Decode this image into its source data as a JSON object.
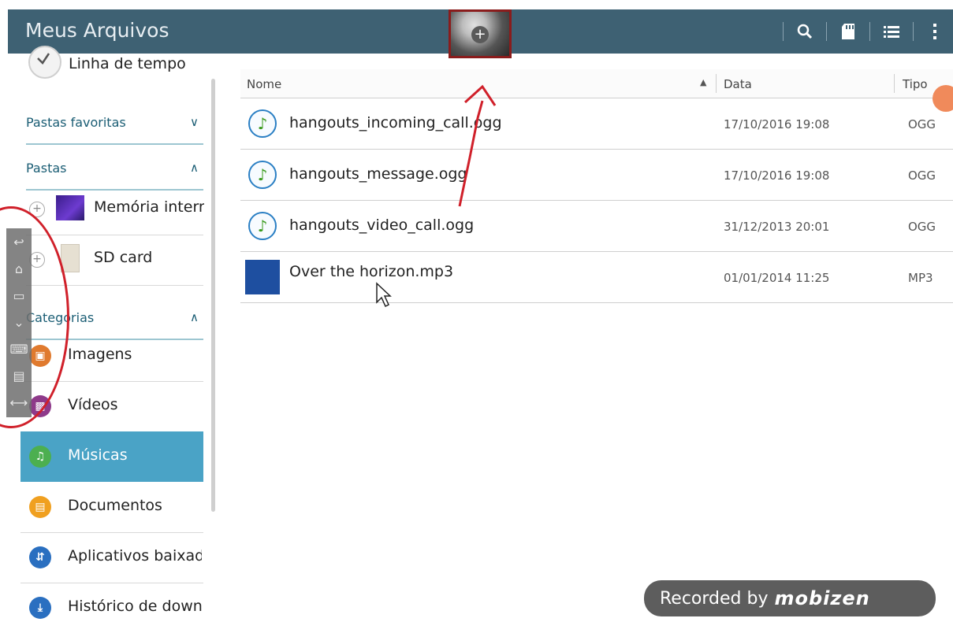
{
  "app": {
    "title": "Meus Arquivos"
  },
  "toolbar": {
    "icons": [
      "search-icon",
      "sd-card-icon",
      "list-view-icon",
      "more-vert-icon"
    ]
  },
  "sidebar": {
    "timeline_label": "Linha de tempo",
    "favorites_header": "Pastas favoritas",
    "folders_header": "Pastas",
    "folders": [
      {
        "label": "Memória interna"
      },
      {
        "label": "SD card"
      }
    ],
    "categories_header": "Categorias",
    "categories": [
      {
        "label": "Imagens",
        "color": "#e07a2e"
      },
      {
        "label": "Vídeos",
        "color": "#8e3a8a"
      },
      {
        "label": "Músicas",
        "color": "#4caf50",
        "selected": true
      },
      {
        "label": "Documentos",
        "color": "#f0a020"
      },
      {
        "label": "Aplicativos baixados",
        "color": "#2a6fc0"
      },
      {
        "label": "Histórico de download",
        "color": "#2a6fc0"
      }
    ]
  },
  "list": {
    "columns": {
      "name": "Nome",
      "date": "Data",
      "type": "Tipo"
    },
    "files": [
      {
        "name": "hangouts_incoming_call.ogg",
        "date": "17/10/2016 19:08",
        "type": "OGG",
        "icon": "music-note-icon"
      },
      {
        "name": "hangouts_message.ogg",
        "date": "17/10/2016 19:08",
        "type": "OGG",
        "icon": "music-note-icon"
      },
      {
        "name": "hangouts_video_call.ogg",
        "date": "31/12/2013 20:01",
        "type": "OGG",
        "icon": "music-note-icon"
      },
      {
        "name": "Over the horizon.mp3",
        "date": "01/01/2014 11:25",
        "type": "MP3",
        "icon": "album-art-icon"
      }
    ]
  },
  "recorder": {
    "text": "Recorded by",
    "brand": "mobizen"
  },
  "colors": {
    "action_bar": "#3e6173",
    "selected_category": "#4aa3c6",
    "annotation_red": "#d0202a"
  }
}
